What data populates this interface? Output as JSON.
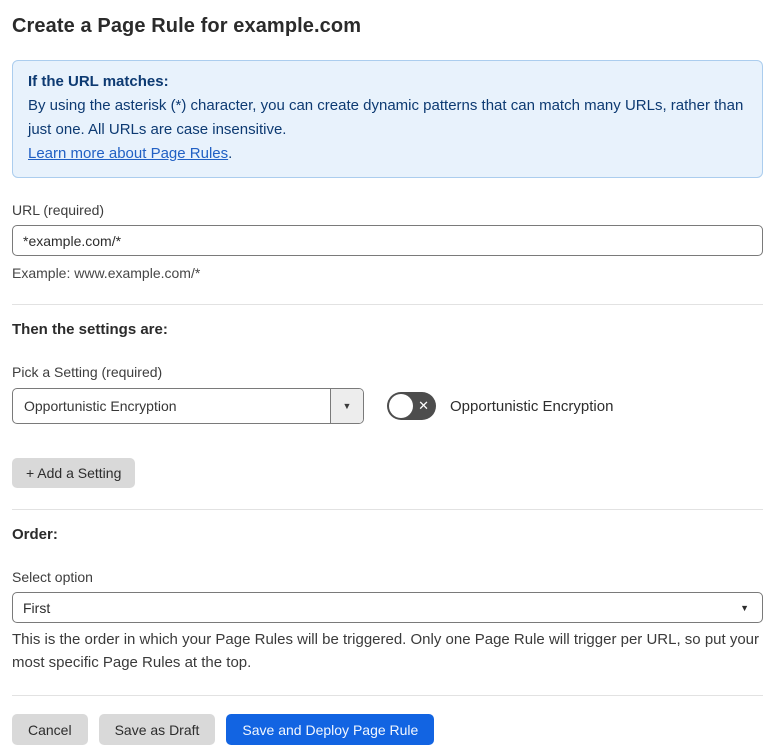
{
  "page": {
    "title": "Create a Page Rule for example.com"
  },
  "info_box": {
    "heading": "If the URL matches:",
    "body": "By using the asterisk (*) character, you can create dynamic patterns that can match many URLs, rather than just one. All URLs are case insensitive.",
    "link": "Learn more about Page Rules",
    "link_suffix": "."
  },
  "url_field": {
    "label": "URL (required)",
    "value": "*example.com/*",
    "helper": "Example: www.example.com/*"
  },
  "settings_section": {
    "heading": "Then the settings are:",
    "setting_label": "Pick a Setting (required)",
    "setting_value": "Opportunistic Encryption",
    "toggle_label": "Opportunistic Encryption",
    "toggle_state": "off",
    "add_button_label": "+ Add a Setting"
  },
  "order_section": {
    "heading": "Order:",
    "select_label": "Select option",
    "select_value": "First",
    "helper": "This is the order in which your Page Rules will be triggered. Only one Page Rule will trigger per URL, so put your most specific Page Rules at the top."
  },
  "footer": {
    "cancel_label": "Cancel",
    "save_draft_label": "Save as Draft",
    "save_deploy_label": "Save and Deploy Page Rule"
  },
  "icons": {
    "chevron_down": "▼",
    "x_glyph": "✕"
  },
  "colors": {
    "primary_blue": "#1264e2",
    "info_bg": "#e8f2fc",
    "info_border": "#abcdee",
    "info_text": "#0d3a72",
    "link_blue": "#2160c4",
    "toggle_off_bg": "#4d4d4d",
    "gray_button_bg": "#d9d9d9"
  }
}
